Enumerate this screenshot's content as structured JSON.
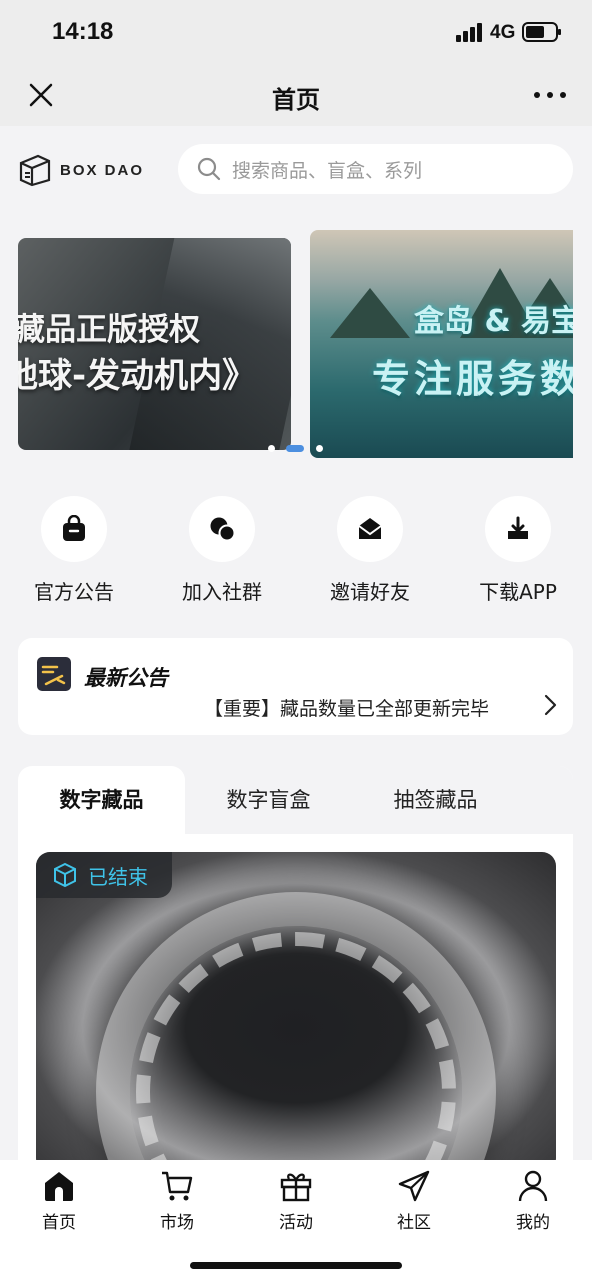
{
  "status_bar": {
    "time": "14:18",
    "network": "4G"
  },
  "nav": {
    "title": "首页"
  },
  "header": {
    "logo_text": "BOX DAO",
    "search_placeholder": "搜索商品、盲盒、系列"
  },
  "banners": [
    {
      "line1": "藏品正版授权",
      "line2": "地球-发动机内》"
    },
    {
      "line1": "盒岛 & 易宝",
      "line2": "专注服务数"
    }
  ],
  "quick_actions": [
    {
      "label": "官方公告",
      "icon": "bag-icon"
    },
    {
      "label": "加入社群",
      "icon": "chat-icon"
    },
    {
      "label": "邀请好友",
      "icon": "envelope-icon"
    },
    {
      "label": "下载APP",
      "icon": "download-icon"
    }
  ],
  "notice": {
    "title": "最新公告",
    "text": "【重要】藏品数量已全部更新完毕"
  },
  "tabs": [
    "数字藏品",
    "数字盲盒",
    "抽签藏品"
  ],
  "card": {
    "status": "已结束"
  },
  "tab_bar": [
    {
      "label": "首页",
      "icon": "home-icon"
    },
    {
      "label": "市场",
      "icon": "cart-icon"
    },
    {
      "label": "活动",
      "icon": "gift-icon"
    },
    {
      "label": "社区",
      "icon": "send-icon"
    },
    {
      "label": "我的",
      "icon": "user-icon"
    }
  ],
  "colors": {
    "accent": "#4c8fe0",
    "status_text": "#3fc3e8",
    "background": "#f3f3f5"
  }
}
